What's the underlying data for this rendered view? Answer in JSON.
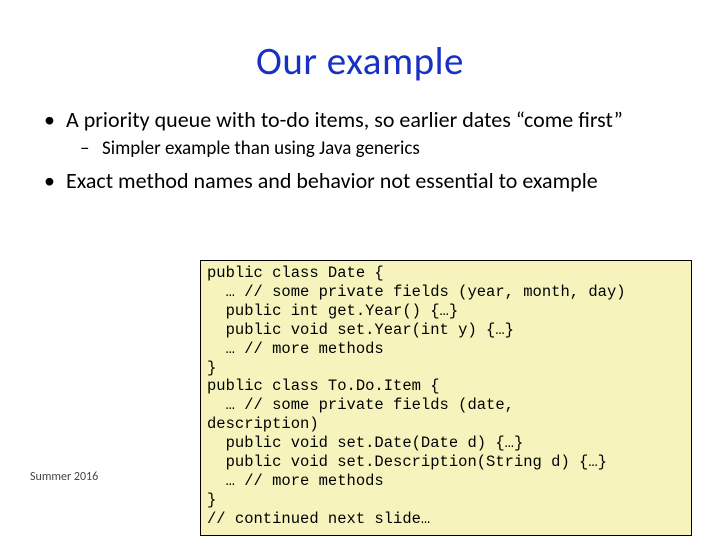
{
  "title": "Our example",
  "bullets": {
    "b1": "A priority queue with to-do items, so earlier dates “come first”",
    "b1_sub1": "Simpler example than using Java generics",
    "b2": "Exact method names and behavior not essential to example"
  },
  "code": "public class Date {\n  … // some private fields (year, month, day)\n  public int get.Year() {…}\n  public void set.Year(int y) {…}\n  … // more methods\n}\npublic class To.Do.Item {\n  … // some private fields (date,\ndescription)\n  public void set.Date(Date d) {…}\n  public void set.Description(String d) {…}\n  … // more methods\n}\n// continued next slide…",
  "footer": "Summer 2016"
}
